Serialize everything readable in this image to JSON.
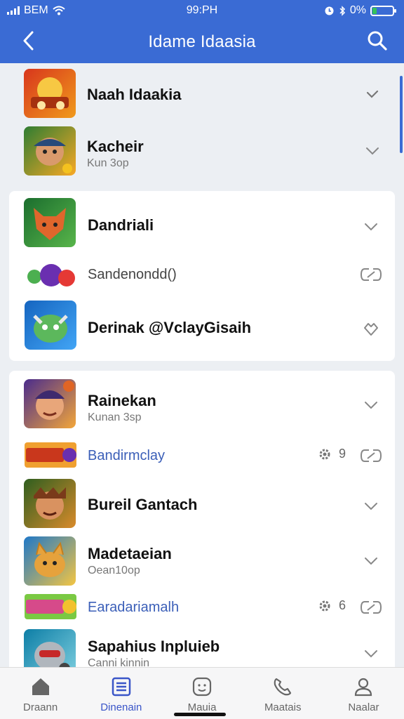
{
  "status_bar": {
    "carrier": "BEM",
    "time": "99:PH",
    "battery": "0%",
    "battery_level": 0.2
  },
  "header": {
    "title": "Idame Idaasia",
    "back_icon": "chevron-left-icon",
    "search_icon": "search-icon"
  },
  "section1": {
    "items": [
      {
        "title": "Naah Idaakia",
        "subtitle": "",
        "icon": "game-thumb-orange",
        "chevron": "check-chevron-icon"
      },
      {
        "title": "Kacheir",
        "subtitle": "Kun 3op",
        "icon": "game-thumb-pirate",
        "chevron": "chevron-down-icon"
      }
    ]
  },
  "section2": {
    "items": [
      {
        "title": "Dandriali",
        "icon": "game-thumb-fox",
        "chevron": "chevron-down-icon"
      },
      {
        "title": "Sandenondd()",
        "icon": "game-thumb-balls",
        "chevron": "link-icon"
      },
      {
        "title": "Derinak @VclayGisaih",
        "icon": "game-thumb-monster",
        "chevron": "heart-outline-icon"
      }
    ]
  },
  "section3": {
    "items": [
      {
        "title": "Rainekan",
        "subtitle": "Kunan 3sp",
        "icon": "game-thumb-hero",
        "chevron": "chevron-down-icon"
      },
      {
        "title": "Bandirmclay",
        "meta_count": "9",
        "icon": "game-thumb-banner",
        "chevron": "link-icon"
      },
      {
        "title": "Bureil Gantach",
        "icon": "game-thumb-warrior",
        "chevron": "chevron-down-icon"
      },
      {
        "title": "Madetaeian",
        "subtitle": "Oean10op",
        "icon": "game-thumb-cat",
        "chevron": "chevron-down-icon"
      },
      {
        "title": "Earadariamalh",
        "meta_count": "6",
        "icon": "game-thumb-banner2",
        "chevron": "link-icon"
      },
      {
        "title": "Sapahius Inpluieb",
        "subtitle": "Canni kinnin",
        "icon": "game-thumb-robot",
        "chevron": "chevron-down-icon"
      }
    ]
  },
  "tabs": [
    {
      "label": "Draann",
      "icon": "home-icon",
      "active": false
    },
    {
      "label": "Dinenain",
      "icon": "list-icon",
      "active": true
    },
    {
      "label": "Mauia",
      "icon": "face-icon",
      "active": false
    },
    {
      "label": "Maatais",
      "icon": "phone-icon",
      "active": false
    },
    {
      "label": "Naalar",
      "icon": "person-icon",
      "active": false
    }
  ],
  "colors": {
    "accent": "#3a6bd4",
    "tab_active": "#3a55c8",
    "link_text": "#3b5fb8"
  }
}
